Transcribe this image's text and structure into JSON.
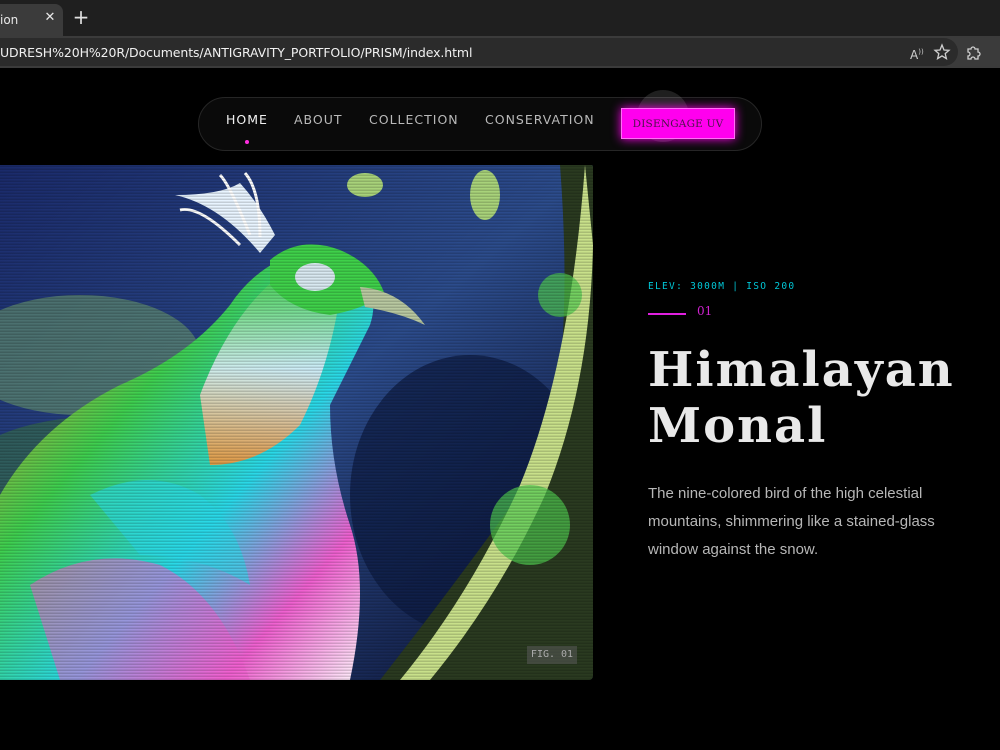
{
  "browser": {
    "tab_title": "ion",
    "tab_close": "✕",
    "new_tab": "+",
    "url": "UDRESH%20H%20R/Documents/ANTIGRAVITY_PORTFOLIO/PRISM/index.html",
    "read_aloud_label": "A",
    "icons": [
      "read-aloud-icon",
      "favorite-star-icon",
      "extensions-icon"
    ]
  },
  "nav": {
    "links": [
      "HOME",
      "ABOUT",
      "COLLECTION",
      "CONSERVATION"
    ],
    "active": "HOME",
    "uv_button": "DISENGAGE UV"
  },
  "hero": {
    "fig_label": "FIG. 01",
    "meta": "ELEV: 3000M | ISO 200",
    "number": "01",
    "title": "Himalayan Monal",
    "description": "The nine-colored bird of the high celestial mountains, shimmering like a stained-glass window against the snow."
  },
  "colors": {
    "accent_magenta": "#ff00ee",
    "accent_cyan": "#00c6d6",
    "background": "#000000"
  }
}
